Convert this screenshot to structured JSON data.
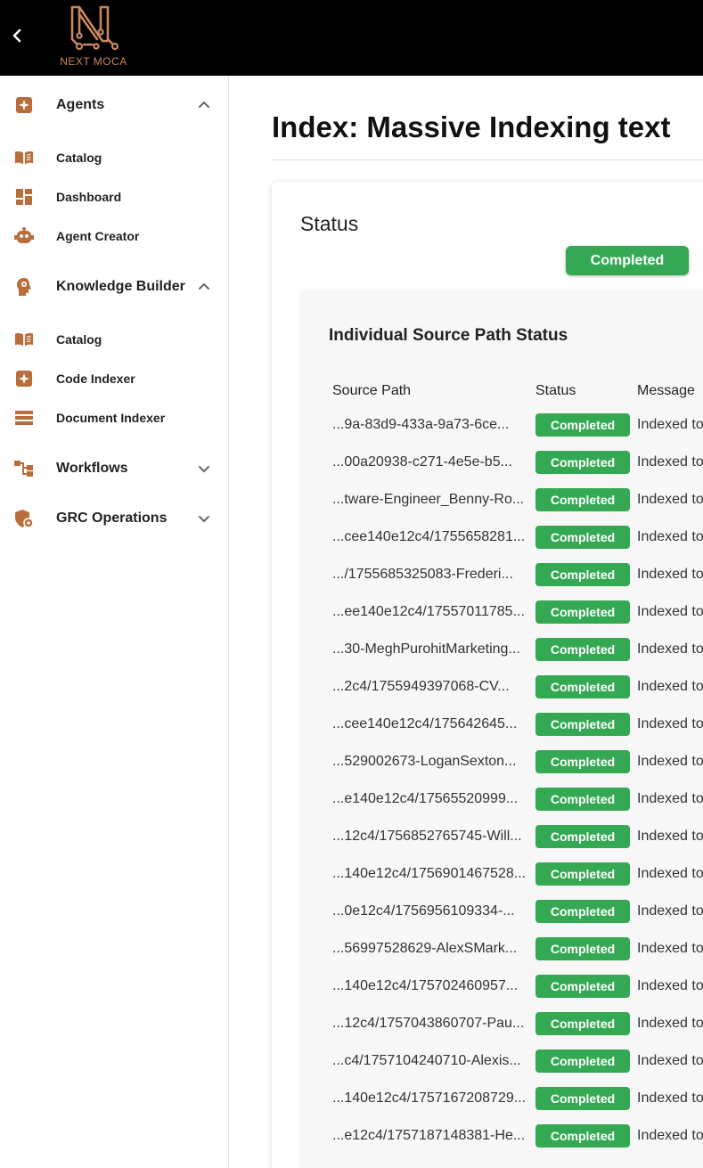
{
  "app": {
    "logo_text": "NEXT MOCA",
    "brand_color": "#c8875f"
  },
  "sidebar": {
    "groups": [
      {
        "label": "Agents",
        "icon": "sparkle-badge-icon",
        "expanded": true,
        "items": [
          {
            "label": "Catalog",
            "icon": "book-icon"
          },
          {
            "label": "Dashboard",
            "icon": "dashboard-icon"
          },
          {
            "label": "Agent Creator",
            "icon": "robot-icon"
          }
        ]
      },
      {
        "label": "Knowledge Builder",
        "icon": "brain-head-icon",
        "expanded": true,
        "items": [
          {
            "label": "Catalog",
            "icon": "book-icon"
          },
          {
            "label": "Code Indexer",
            "icon": "sparkle-badge-icon"
          },
          {
            "label": "Document Indexer",
            "icon": "list-lines-icon"
          }
        ]
      },
      {
        "label": "Workflows",
        "icon": "workflow-icon",
        "expanded": false,
        "items": []
      },
      {
        "label": "GRC Operations",
        "icon": "shield-icon",
        "expanded": false,
        "items": []
      }
    ]
  },
  "main": {
    "title": "Index: Massive Indexing text",
    "status_label": "Status",
    "overall_status": "Completed",
    "status_color": "#34a853",
    "table": {
      "title": "Individual Source Path Status",
      "columns": [
        "Source Path",
        "Status",
        "Message"
      ],
      "rows": [
        {
          "path": "...9a-83d9-433a-9a73-6ce...",
          "status": "Completed",
          "message": "Indexed to"
        },
        {
          "path": "...00a20938-c271-4e5e-b5...",
          "status": "Completed",
          "message": "Indexed to"
        },
        {
          "path": "...tware-Engineer_Benny-Ro...",
          "status": "Completed",
          "message": "Indexed to"
        },
        {
          "path": "...cee140e12c4/1755658281...",
          "status": "Completed",
          "message": "Indexed to"
        },
        {
          "path": ".../1755685325083-Frederi...",
          "status": "Completed",
          "message": "Indexed to"
        },
        {
          "path": "...ee140e12c4/17557011785...",
          "status": "Completed",
          "message": "Indexed to"
        },
        {
          "path": "...30-MeghPurohitMarketing...",
          "status": "Completed",
          "message": "Indexed to"
        },
        {
          "path": "...2c4/1755949397068-CV...",
          "status": "Completed",
          "message": "Indexed to"
        },
        {
          "path": "...cee140e12c4/175642645...",
          "status": "Completed",
          "message": "Indexed to"
        },
        {
          "path": "...529002673-LoganSexton...",
          "status": "Completed",
          "message": "Indexed to"
        },
        {
          "path": "...e140e12c4/17565520999...",
          "status": "Completed",
          "message": "Indexed to"
        },
        {
          "path": "...12c4/1756852765745-Will...",
          "status": "Completed",
          "message": "Indexed to"
        },
        {
          "path": "...140e12c4/1756901467528...",
          "status": "Completed",
          "message": "Indexed to"
        },
        {
          "path": "...0e12c4/1756956109334-...",
          "status": "Completed",
          "message": "Indexed to"
        },
        {
          "path": "...56997528629-AlexSMark...",
          "status": "Completed",
          "message": "Indexed to"
        },
        {
          "path": "...140e12c4/175702460957...",
          "status": "Completed",
          "message": "Indexed to"
        },
        {
          "path": "...12c4/1757043860707-Pau...",
          "status": "Completed",
          "message": "Indexed to"
        },
        {
          "path": "...c4/1757104240710-Alexis...",
          "status": "Completed",
          "message": "Indexed to"
        },
        {
          "path": "...140e12c4/1757167208729...",
          "status": "Completed",
          "message": "Indexed to"
        },
        {
          "path": "...e12c4/1757187148381-He...",
          "status": "Completed",
          "message": "Indexed to"
        }
      ]
    }
  }
}
